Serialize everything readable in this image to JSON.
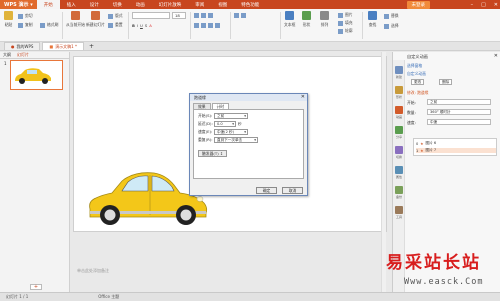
{
  "titlebar": {
    "app_name": "WPS 演示",
    "tabs": [
      "开始",
      "插入",
      "设计",
      "切换",
      "动画",
      "幻灯片放映",
      "审阅",
      "视图",
      "特色功能"
    ],
    "active_tab": "开始",
    "login_label": "未登录",
    "colors": {
      "bar": "#c8461f",
      "accent": "#e8763a"
    }
  },
  "ribbon": {
    "paste": "粘贴",
    "cut": "剪切",
    "copy": "复制",
    "format_painter": "格式刷",
    "from_current": "从当前开始",
    "new_slide": "新建幻灯片",
    "layout": "版式",
    "reset": "重置",
    "font_size": "18",
    "arrange": "排列",
    "text_box": "文本框",
    "shape": "形状",
    "picture": "图片",
    "fill": "填充",
    "outline": "轮廓",
    "find": "查找",
    "replace": "替换",
    "select": "选择"
  },
  "doctabs": [
    {
      "label": "我的WPS",
      "active": false
    },
    {
      "label": "演示文稿1 *",
      "active": true
    }
  ],
  "leftpanel": {
    "tabs": [
      "大纲",
      "幻灯片"
    ],
    "active_tab": "幻灯片",
    "slide_number": "1",
    "add_label": "+"
  },
  "notes_placeholder": "单击此处添加备注",
  "dialog": {
    "title": "跑道缘",
    "tabs": [
      "效果",
      "计时"
    ],
    "active_tab": "计时",
    "rows": [
      {
        "label": "开始(S):",
        "value": "之前"
      },
      {
        "label": "延迟(D):",
        "value": "0.0",
        "unit": "秒"
      },
      {
        "label": "速度(E):",
        "value": "中速(2 秒)"
      },
      {
        "label": "重复(R):",
        "value": "直到下一次单击"
      }
    ],
    "trigger_label": "触发器(T) ↕",
    "ok_label": "确定",
    "cancel_label": "取消"
  },
  "rightpanel": {
    "title": "自定义动画",
    "select_pane": "选择窗格",
    "section_title": "自定义动画",
    "change_label": "更改",
    "delete_label": "删除",
    "modify_label": "修改: 跑道缘",
    "start_label": "开始:",
    "start_value": "之前",
    "property_label": "数量:",
    "property_value": "360° 顺时针",
    "speed_label": "速度:",
    "speed_value": "中速",
    "items": [
      {
        "index": "0",
        "name": "图片 6"
      },
      {
        "index": "1",
        "name": "图片 7"
      }
    ],
    "side_icons": [
      "新建",
      "形状",
      "动画",
      "分享",
      "切换",
      "属性",
      "备份",
      "工具"
    ]
  },
  "statusbar": {
    "slide_info": "幻灯片 1 / 1",
    "theme": "Office 主题"
  },
  "watermark": {
    "cn": "易采站长站",
    "en": "Www.easck.Com"
  }
}
